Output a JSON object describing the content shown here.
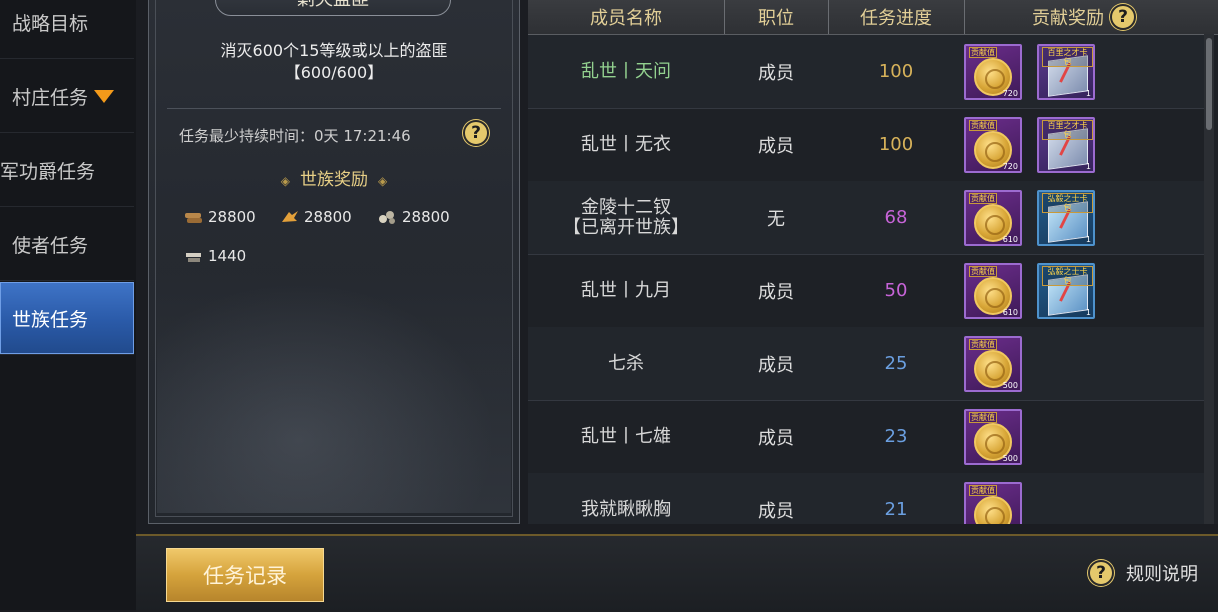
{
  "sidebar": {
    "items": [
      {
        "label": "战略目标"
      },
      {
        "label": "村庄任务"
      },
      {
        "label": "军功爵任务"
      },
      {
        "label": "使者任务"
      },
      {
        "label": "世族任务"
      }
    ]
  },
  "task": {
    "title": "剿灭盗匪",
    "goal_line1": "消灭600个15等级或以上的盗匪",
    "goal_line2": "【600/600】",
    "duration": "任务最少持续时间：0天 17:21:46",
    "reward_title": "世族奖励",
    "rewards": [
      {
        "icon": "wood-icon",
        "value": "28800"
      },
      {
        "icon": "grain-icon",
        "value": "28800"
      },
      {
        "icon": "stone-icon",
        "value": "28800"
      },
      {
        "icon": "iron-icon",
        "value": "1440"
      }
    ]
  },
  "table": {
    "headers": {
      "name": "成员名称",
      "role": "职位",
      "progress": "任务进度",
      "reward": "贡献奖励"
    },
    "rows": [
      {
        "name": "乱世丨天问",
        "name2": "",
        "role": "成员",
        "progress": "100",
        "items": [
          {
            "type": "coin",
            "label": "贡献值",
            "qty": "720"
          },
          {
            "type": "pack-purple",
            "label": "百里之才卡包",
            "qty": "1"
          }
        ]
      },
      {
        "name": "乱世丨无衣",
        "name2": "",
        "role": "成员",
        "progress": "100",
        "items": [
          {
            "type": "coin",
            "label": "贡献值",
            "qty": "720"
          },
          {
            "type": "pack-purple",
            "label": "百里之才卡包",
            "qty": "1"
          }
        ]
      },
      {
        "name": "金陵十二钗",
        "name2": "【已离开世族】",
        "role": "无",
        "progress": "68",
        "items": [
          {
            "type": "coin",
            "label": "贡献值",
            "qty": "610"
          },
          {
            "type": "pack-blue",
            "label": "弘毅之士卡包",
            "qty": "1"
          }
        ]
      },
      {
        "name": "乱世丨九月",
        "name2": "",
        "role": "成员",
        "progress": "50",
        "items": [
          {
            "type": "coin",
            "label": "贡献值",
            "qty": "610"
          },
          {
            "type": "pack-blue",
            "label": "弘毅之士卡包",
            "qty": "1"
          }
        ]
      },
      {
        "name": "七杀",
        "name2": "",
        "role": "成员",
        "progress": "25",
        "items": [
          {
            "type": "coin",
            "label": "贡献值",
            "qty": "500"
          }
        ]
      },
      {
        "name": "乱世丨七雄",
        "name2": "",
        "role": "成员",
        "progress": "23",
        "items": [
          {
            "type": "coin",
            "label": "贡献值",
            "qty": "500"
          }
        ]
      },
      {
        "name": "我就瞅瞅胸",
        "name2": "",
        "role": "成员",
        "progress": "21",
        "items": [
          {
            "type": "coin",
            "label": "贡献值",
            "qty": ""
          }
        ]
      }
    ]
  },
  "footer": {
    "record_label": "任务记录",
    "rules_label": "规则说明"
  },
  "colors": {
    "gold": "#e2cf97",
    "accent_blue": "#3f74c7",
    "progress_gold": "#d7b25a",
    "progress_purple": "#c764d8",
    "progress_blue": "#6b9fe0",
    "green_name": "#93d18f"
  }
}
